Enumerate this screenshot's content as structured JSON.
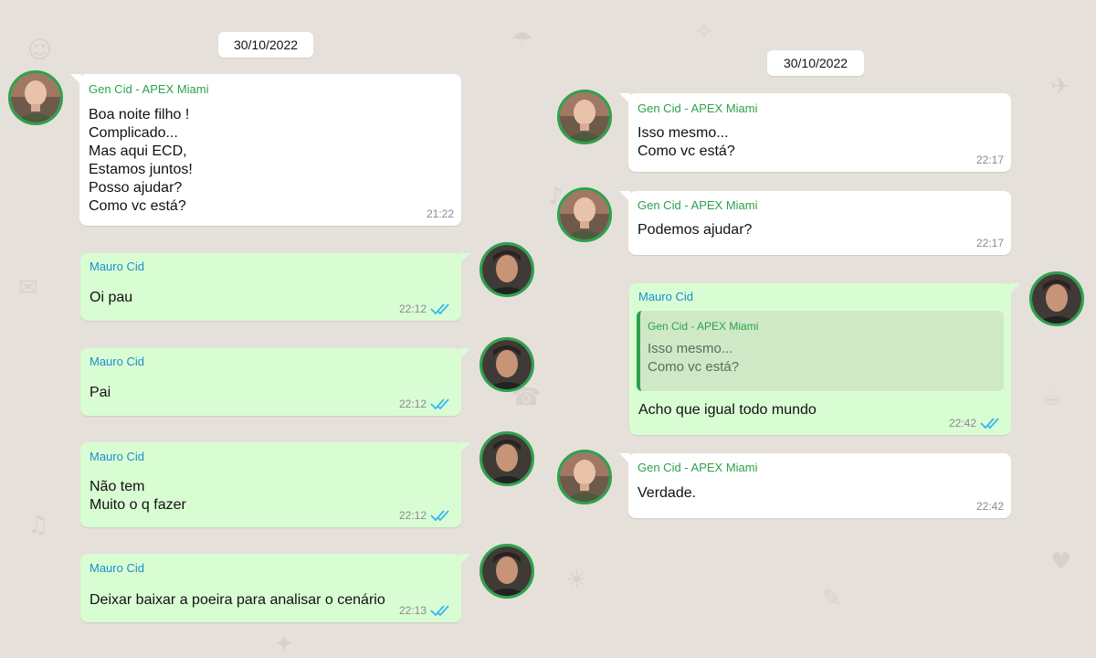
{
  "colors": {
    "background": "#e6e0da",
    "incoming_bubble": "#ffffff",
    "outgoing_bubble": "#d9fdd3",
    "gen_name": "#2ca24c",
    "mauro_name": "#1a8dd0",
    "read_ticks": "#34b7f1",
    "avatar_ring": "#2ca24c"
  },
  "left_column": {
    "date": "30/10/2022",
    "messages": [
      {
        "direction": "incoming",
        "sender": "Gen Cid - APEX Miami",
        "text": "Boa noite filho !\nComplicado...\nMas aqui ECD,\nEstamos juntos!\nPosso ajudar?\nComo vc está?",
        "time": "21:22",
        "avatar": "gen-cid-avatar"
      },
      {
        "direction": "outgoing",
        "sender": "Mauro Cid",
        "text": "Oi pau",
        "time": "22:12",
        "status_icon": "double-check-read-icon",
        "avatar": "mauro-cid-avatar"
      },
      {
        "direction": "outgoing",
        "sender": "Mauro Cid",
        "text": "Pai",
        "time": "22:12",
        "status_icon": "double-check-read-icon",
        "avatar": "mauro-cid-avatar"
      },
      {
        "direction": "outgoing",
        "sender": "Mauro Cid",
        "text": "Não tem\nMuito o q fazer",
        "time": "22:12",
        "status_icon": "double-check-read-icon",
        "avatar": "mauro-cid-avatar"
      },
      {
        "direction": "outgoing",
        "sender": "Mauro Cid",
        "text": "Deixar baixar a poeira para analisar o cenário",
        "time": "22:13",
        "status_icon": "double-check-read-icon",
        "avatar": "mauro-cid-avatar"
      }
    ]
  },
  "right_column": {
    "date": "30/10/2022",
    "messages": [
      {
        "direction": "incoming",
        "sender": "Gen Cid - APEX Miami",
        "text": "Isso mesmo...\nComo vc está?",
        "time": "22:17",
        "avatar": "gen-cid-avatar"
      },
      {
        "direction": "incoming",
        "sender": "Gen Cid - APEX Miami",
        "text": "Podemos ajudar?",
        "time": "22:17",
        "avatar": "gen-cid-avatar"
      },
      {
        "direction": "outgoing",
        "sender": "Mauro Cid",
        "quoted": {
          "sender": "Gen Cid - APEX Miami",
          "text": "Isso mesmo...\nComo vc está?"
        },
        "text": "Acho que igual todo mundo",
        "time": "22:42",
        "status_icon": "double-check-read-icon",
        "avatar": "mauro-cid-avatar"
      },
      {
        "direction": "incoming",
        "sender": "Gen Cid - APEX Miami",
        "text": "Verdade.",
        "time": "22:42",
        "avatar": "gen-cid-avatar"
      }
    ]
  }
}
